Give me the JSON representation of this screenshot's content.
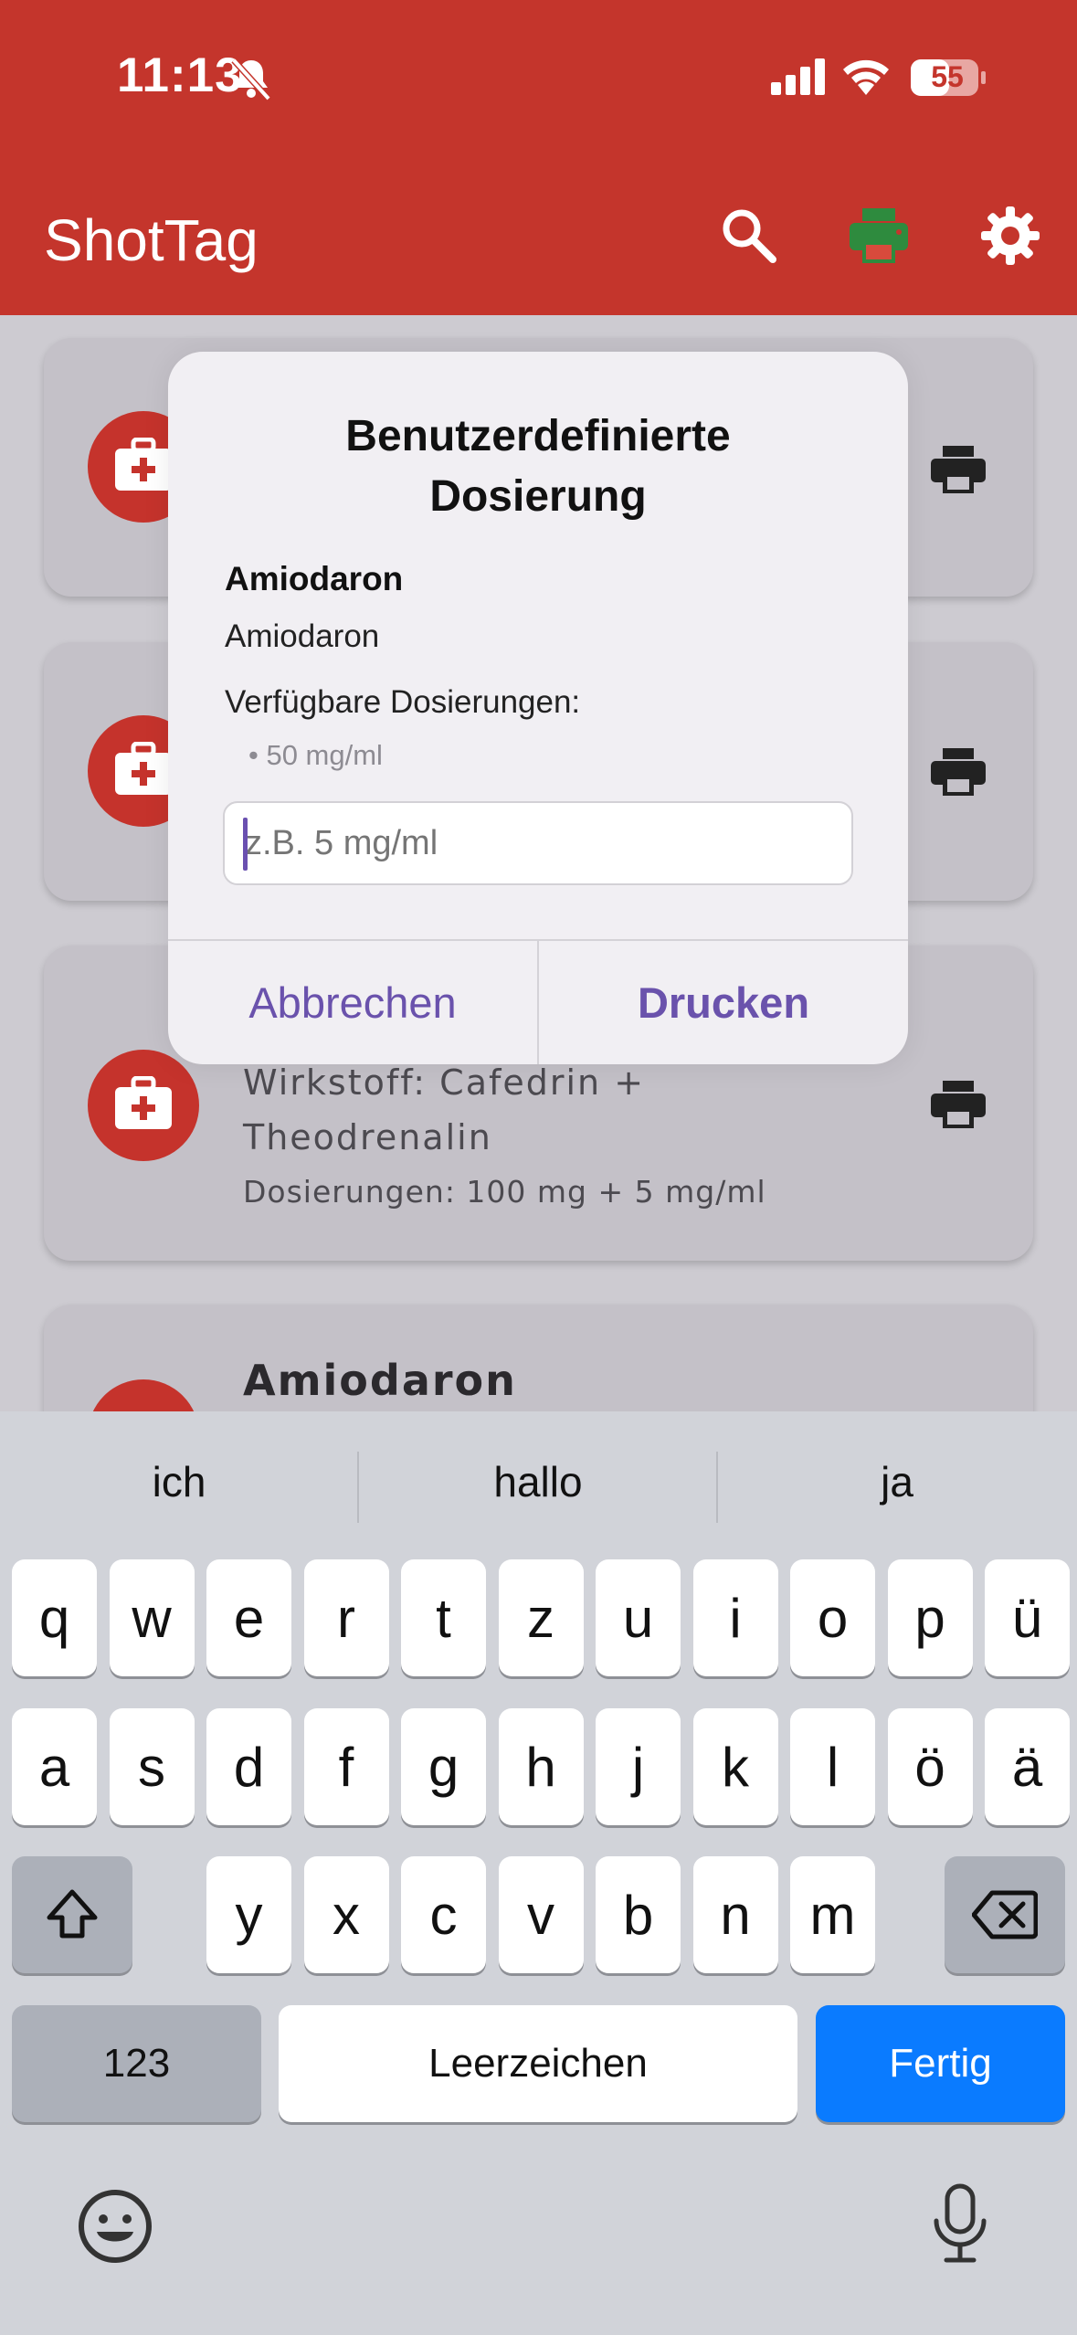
{
  "status": {
    "time": "11:13",
    "battery": "55"
  },
  "app": {
    "title": "ShotTag"
  },
  "cards": [
    {
      "title": "",
      "ingredient": "",
      "dose": ""
    },
    {
      "title": "",
      "ingredient": "",
      "dose": ""
    },
    {
      "title": "",
      "ingredient_line1": "Wirkstoff: Cafedrin +",
      "ingredient_line2": "Theodrenalin",
      "dose": "Dosierungen: 100 mg + 5 mg/ml"
    },
    {
      "title": "Amiodaron"
    }
  ],
  "dialog": {
    "title_line1": "Benutzerdefinierte",
    "title_line2": "Dosierung",
    "drug_name": "Amiodaron",
    "drug_subtitle": "Amiodaron",
    "available_label": "Verfügbare Dosierungen:",
    "available_items": [
      "• 50 mg/ml"
    ],
    "input_placeholder": "z.B. 5 mg/ml",
    "input_value": "",
    "cancel_label": "Abbrechen",
    "print_label": "Drucken"
  },
  "keyboard": {
    "suggestions": [
      "ich",
      "hallo",
      "ja"
    ],
    "row1": [
      "q",
      "w",
      "e",
      "r",
      "t",
      "z",
      "u",
      "i",
      "o",
      "p",
      "ü"
    ],
    "row2": [
      "a",
      "s",
      "d",
      "f",
      "g",
      "h",
      "j",
      "k",
      "l",
      "ö",
      "ä"
    ],
    "row3": [
      "y",
      "x",
      "c",
      "v",
      "b",
      "n",
      "m"
    ],
    "numbers_label": "123",
    "space_label": "Leerzeichen",
    "done_label": "Fertig"
  },
  "colors": {
    "brand_red": "#c4352c",
    "accent_purple": "#6a52ac",
    "keyboard_blue": "#0a7bff",
    "print_green": "#2e8b3e"
  }
}
